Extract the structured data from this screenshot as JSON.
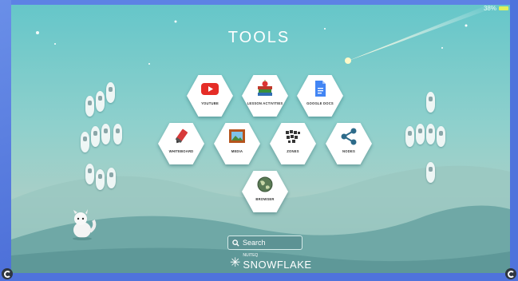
{
  "status": {
    "battery": "38%"
  },
  "title": "TOOLS",
  "tools": [
    {
      "label": "YOUTUBE",
      "icon": "youtube-icon"
    },
    {
      "label": "LESSON ACTIVITIES",
      "icon": "books-apple-icon"
    },
    {
      "label": "GOOGLE DOCS",
      "icon": "google-docs-icon"
    },
    {
      "label": "WHITEBOARD",
      "icon": "marker-icon"
    },
    {
      "label": "MEDIA",
      "icon": "picture-frame-icon"
    },
    {
      "label": "ZONES",
      "icon": "zones-grid-icon"
    },
    {
      "label": "NODES",
      "icon": "share-nodes-icon"
    },
    {
      "label": "BROWSER",
      "icon": "globe-icon"
    }
  ],
  "search": {
    "label": "Search"
  },
  "brand": {
    "small": "NUITEQ",
    "big": "SNOWFLAKE"
  },
  "colors": {
    "accent": "#5b7fe0",
    "youtube": "#e52d27",
    "docs": "#4285f4",
    "battery": "#dff25a"
  }
}
